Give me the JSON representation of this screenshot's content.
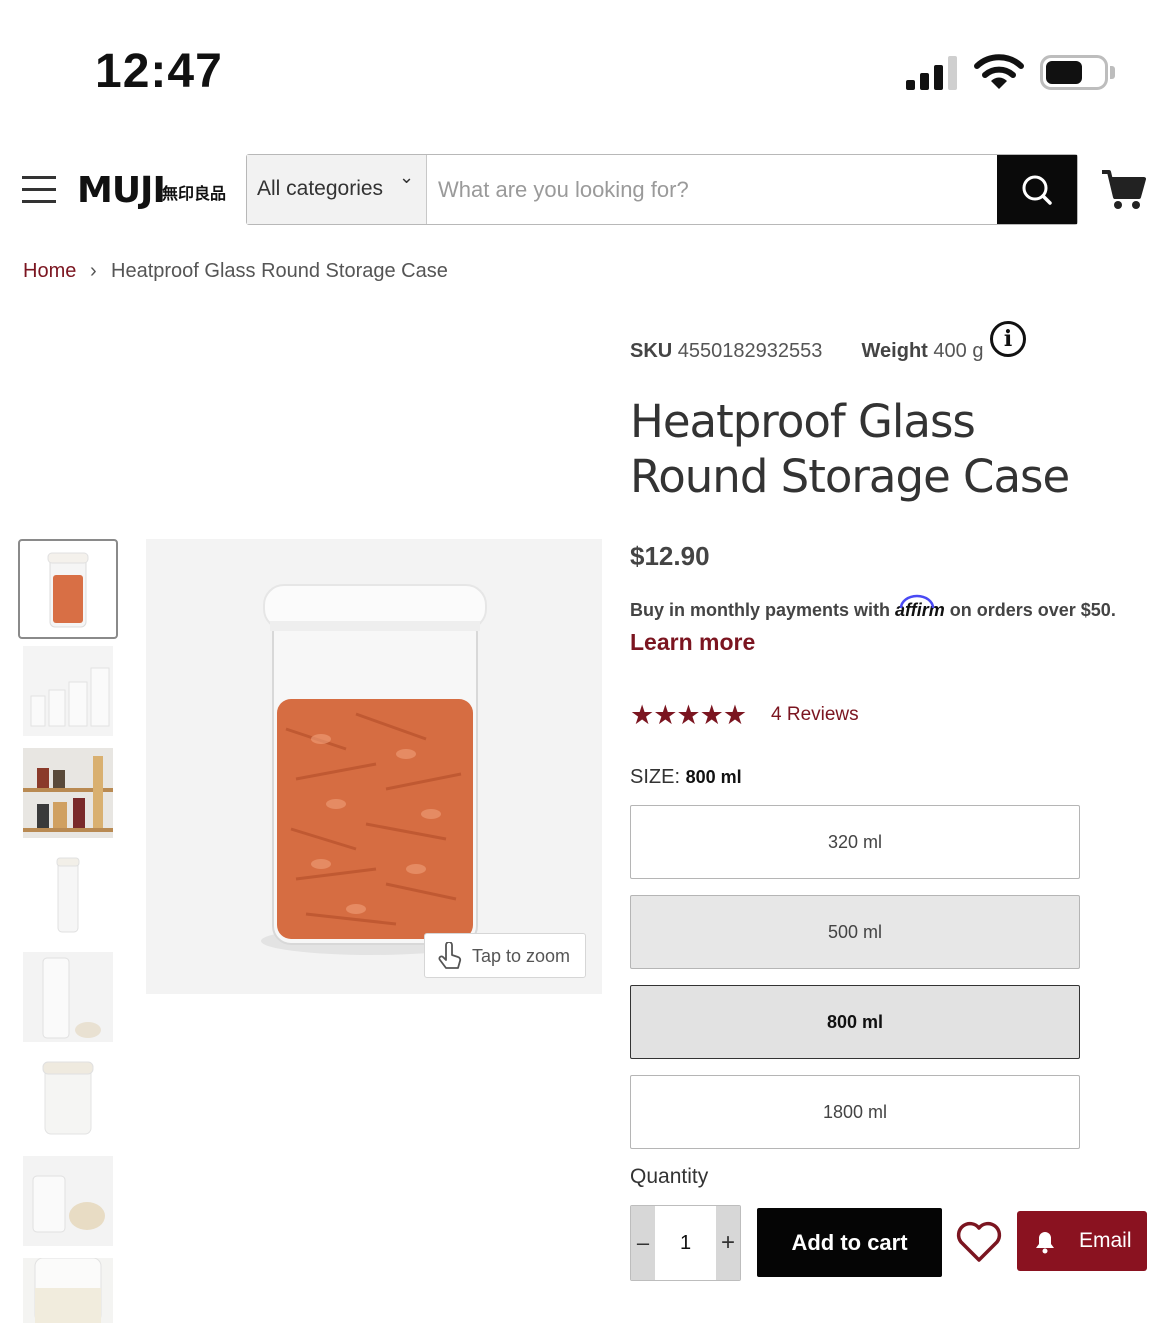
{
  "status_bar": {
    "time": "12:47"
  },
  "header": {
    "logo": "MUJI",
    "logo_jp": "無印良品",
    "category_select": "All categories",
    "search_placeholder": "What are you looking for?"
  },
  "breadcrumb": {
    "home": "Home",
    "separator": "›",
    "current": "Heatproof Glass Round Storage Case"
  },
  "gallery": {
    "zoom_hint": "Tap to zoom"
  },
  "product": {
    "sku_label": "SKU",
    "sku": "4550182932553",
    "weight_label": "Weight",
    "weight": "400 g",
    "title": "Heatproof Glass Round Storage Case",
    "price": "$12.90",
    "affirm_prefix": "Buy in monthly payments with",
    "affirm_brand": "affirm",
    "affirm_suffix": "on orders over $50.",
    "learn_more": "Learn more",
    "rating": 5,
    "stars": "★★★★★",
    "reviews": "4 Reviews",
    "size_label": "SIZE:",
    "size_selected": "800 ml",
    "sizes": [
      "320 ml",
      "500 ml",
      "800 ml",
      "1800 ml"
    ],
    "quantity_label": "Quantity",
    "quantity_minus": "–",
    "quantity_value": "1",
    "quantity_plus": "+",
    "add_to_cart": "Add to cart",
    "email": "Email"
  },
  "colors": {
    "accent": "#7b1520",
    "email_button": "#8a1220",
    "cart_button": "#050505"
  }
}
